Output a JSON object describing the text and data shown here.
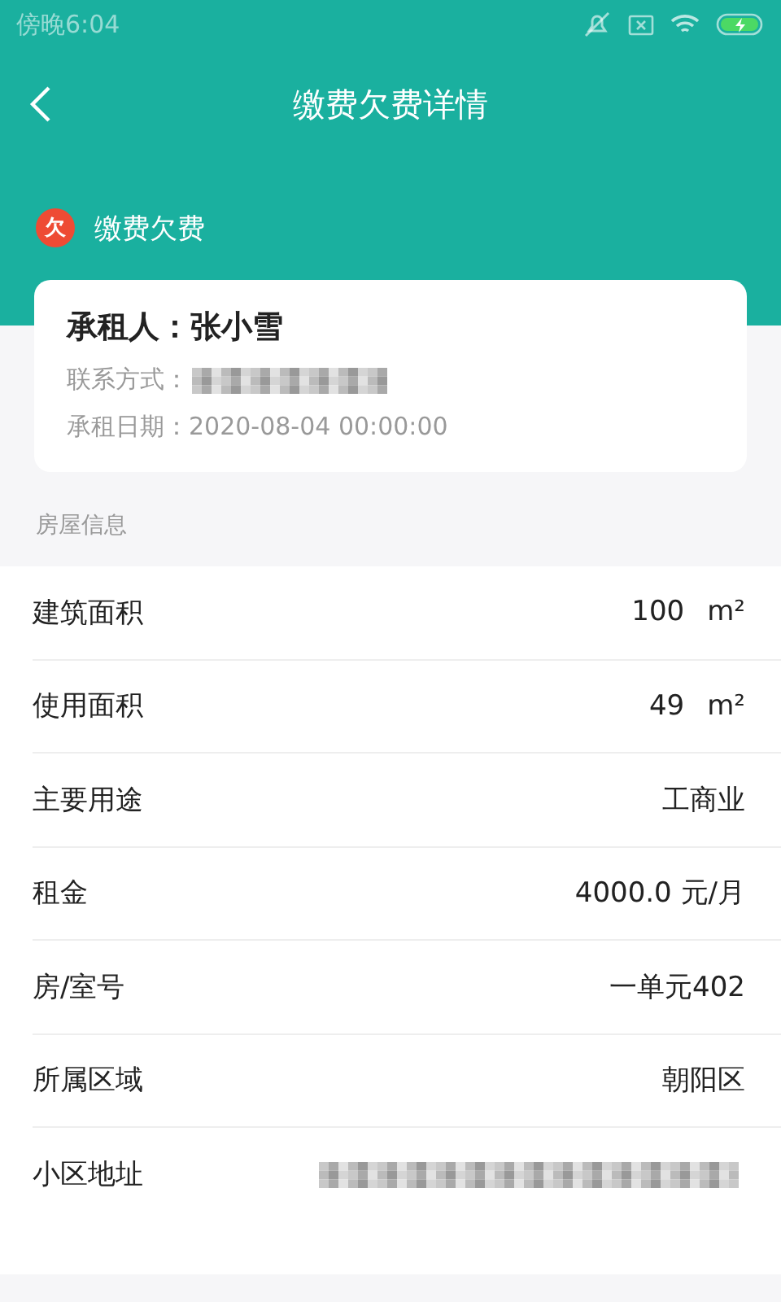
{
  "status_bar": {
    "time": "傍晚6:04"
  },
  "header": {
    "title": "缴费欠费详情"
  },
  "status": {
    "badge": "欠",
    "label": "缴费欠费"
  },
  "tenant": {
    "name_line": "承租人：张小雪",
    "contact_label": "联系方式：",
    "contact_value": {
      "kind": "redacted"
    },
    "date_line": "承租日期：2020-08-04 00:00:00"
  },
  "section_title": "房屋信息",
  "rows": [
    {
      "label": "建筑面积",
      "kind": "text",
      "value": "100",
      "unit": "m²"
    },
    {
      "label": "使用面积",
      "kind": "text",
      "value": "49",
      "unit": "m²"
    },
    {
      "label": "主要用途",
      "kind": "text",
      "value": "工商业"
    },
    {
      "label": "租金",
      "kind": "text",
      "value": "4000.0 元/月"
    },
    {
      "label": "房/室号",
      "kind": "text",
      "value": "一单元402"
    },
    {
      "label": "所属区域",
      "kind": "text",
      "value": "朝阳区"
    },
    {
      "label": "小区地址",
      "kind": "redacted"
    }
  ]
}
